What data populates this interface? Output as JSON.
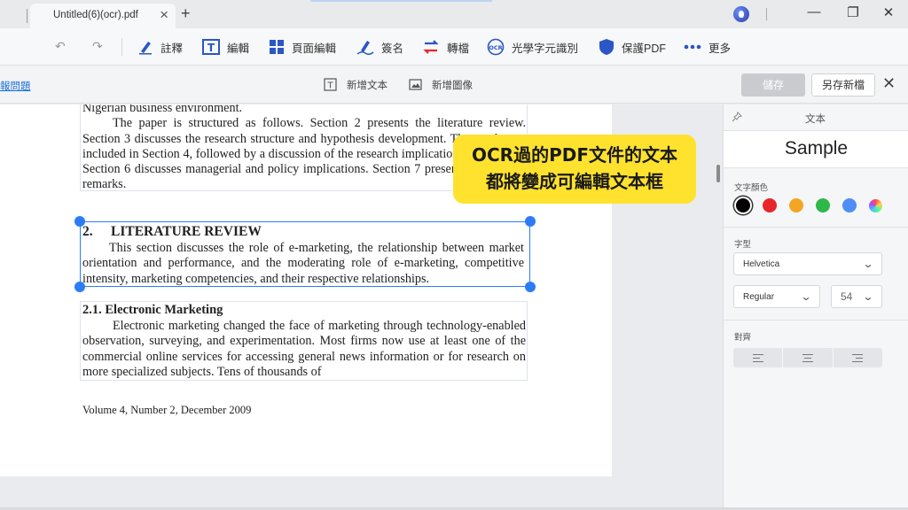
{
  "tab": {
    "title": "Untitled(6)(ocr).pdf",
    "close": "×",
    "add": "+"
  },
  "window": {
    "minimize": "—",
    "restore": "❐",
    "close": "✕"
  },
  "toolbar": {
    "undo": "↶",
    "redo": "↷",
    "annotate": "註釋",
    "edit": "編輯",
    "page_edit": "頁面編輯",
    "sign": "簽名",
    "convert": "轉檔",
    "ocr": "光學字元識別",
    "protect": "保護PDF",
    "more": "更多"
  },
  "subbar": {
    "report": "報問題",
    "add_text": "新增文本",
    "add_image": "新增圖像",
    "save": "儲存",
    "save_as": "另存新檔",
    "close": "✕"
  },
  "document": {
    "p1_line0": "Nigerian business environment.",
    "p1_body": "The paper is structured as follows.  Section 2 presents the literature review. Section 3 discusses the research structure and hypothesis development. The results are included in Section 4, followed by a discussion of the research implications (Section 5).  Section 6 discusses managerial and policy implications.  Section 7 presents concluding remarks.",
    "lit_num": "2.",
    "lit_title": "LITERATURE REVIEW",
    "lit_body": "This section discusses the role of e-marketing, the relationship between market orientation and performance, and the moderating role of e-marketing, competitive intensity, marketing competencies, and their respective relationships.",
    "sec21_title": "2.1.  Electronic Marketing",
    "sec21_body": "Electronic marketing changed the face of marketing through technology-enabled observation, surveying, and experimentation.  Most firms now use at least one of the commercial online services for accessing general news information or for research on more specialized subjects.  Tens of thousands of",
    "volume": "Volume 4, Number 2, December 2009"
  },
  "banner": {
    "line1": "OCR過的PDF文件的文本",
    "line2": "都將變成可編輯文本框"
  },
  "panel": {
    "title": "文本",
    "sample": "Sample",
    "color_label": "文字顏色",
    "font_label": "字型",
    "font": "Helvetica",
    "style": "Regular",
    "size": "54",
    "align_label": "對齊",
    "colors": [
      "#000000",
      "#e8262a",
      "#f5a524",
      "#2fb84a",
      "#4d8ef7"
    ]
  }
}
